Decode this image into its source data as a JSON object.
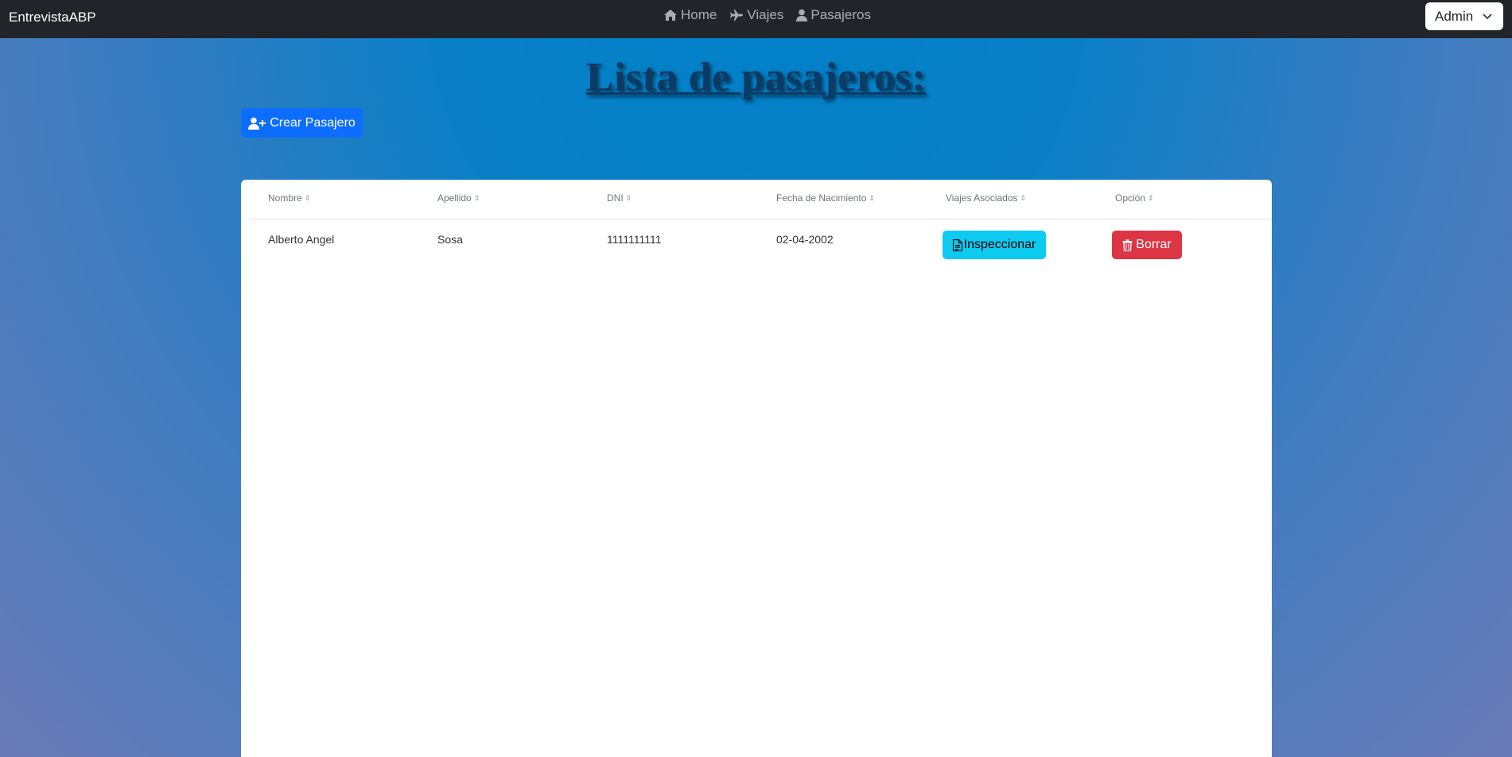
{
  "navbar": {
    "brand": "EntrevistaABP",
    "links": [
      {
        "label": "Home",
        "icon": "home-icon"
      },
      {
        "label": "Viajes",
        "icon": "plane-icon"
      },
      {
        "label": "Pasajeros",
        "icon": "user-icon"
      }
    ],
    "user_select": {
      "value": "Admin",
      "icon": "chevron-down-icon"
    }
  },
  "main": {
    "title": "Lista de pasajeros:",
    "create_button": {
      "label": "Crear Pasajero",
      "icon": "user-plus-icon"
    },
    "table": {
      "columns": [
        "Nombre",
        "Apellido",
        "DNI",
        "Fecha de Nacimiento",
        "Viajes Asociados",
        "Opción"
      ],
      "rows": [
        {
          "nombre": "Alberto Angel",
          "apellido": "Sosa",
          "dni": "1111111111",
          "fecha": "02-04-2002",
          "inspect_label": "Inspeccionar",
          "delete_label": "Borrar"
        }
      ]
    }
  },
  "colors": {
    "navbar": "#212529",
    "primary": "#0d6efd",
    "info": "#0dcaf0",
    "danger": "#dc3545",
    "title": "#0d3b66"
  }
}
